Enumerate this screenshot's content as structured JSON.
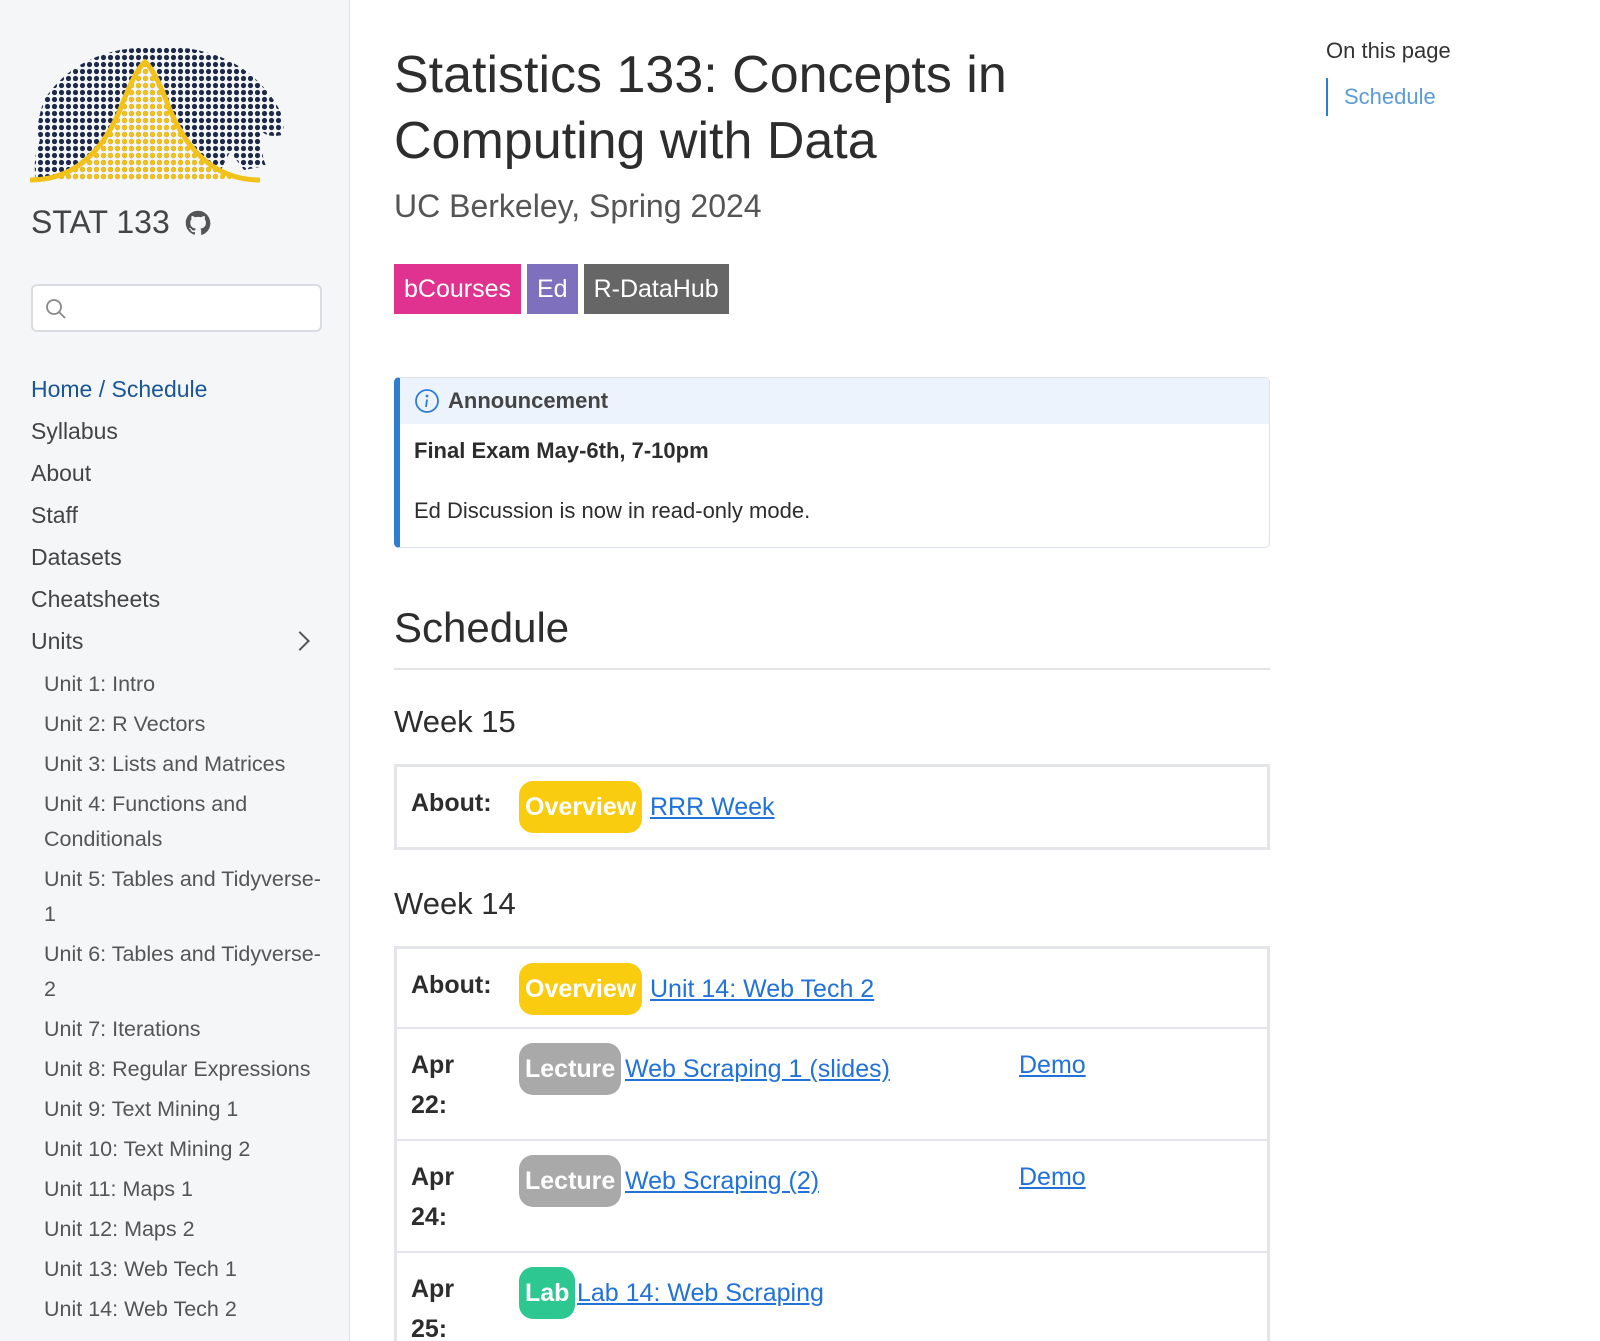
{
  "sidebar": {
    "site_title": "STAT 133",
    "search": {
      "placeholder": "",
      "value": ""
    },
    "nav": [
      {
        "label": "Home / Schedule",
        "active": true
      },
      {
        "label": "Syllabus"
      },
      {
        "label": "About"
      },
      {
        "label": "Staff"
      },
      {
        "label": "Datasets"
      },
      {
        "label": "Cheatsheets"
      }
    ],
    "units_label": "Units",
    "units": [
      "Unit 1: Intro",
      "Unit 2: R Vectors",
      "Unit 3: Lists and Matrices",
      "Unit 4: Functions and Conditionals",
      "Unit 5: Tables and Tidyverse-1",
      "Unit 6: Tables and Tidyverse-2",
      "Unit 7: Iterations",
      "Unit 8: Regular Expressions",
      "Unit 9: Text Mining 1",
      "Unit 10: Text Mining 2",
      "Unit 11: Maps 1",
      "Unit 12: Maps 2",
      "Unit 13: Web Tech 1",
      "Unit 14: Web Tech 2"
    ]
  },
  "main": {
    "title": "Statistics 133: Concepts in Computing with Data",
    "subtitle": "UC Berkeley, Spring 2024",
    "badges": [
      {
        "label": "bCourses",
        "color": "#e0338f"
      },
      {
        "label": "Ed",
        "color": "#7e70bd"
      },
      {
        "label": "R-DataHub",
        "color": "#666666"
      }
    ],
    "announcement": {
      "heading": "Announcement",
      "bold_line": "Final Exam May-6th, 7-10pm",
      "line": "Ed Discussion is now in read-only mode."
    },
    "schedule_heading": "Schedule",
    "weeks": [
      {
        "title": "Week 15",
        "rows": [
          {
            "label": "About:",
            "pill": "Overview",
            "link": "RRR Week"
          }
        ]
      },
      {
        "title": "Week 14",
        "rows": [
          {
            "label": "About:",
            "pill": "Overview",
            "link": "Unit 14: Web Tech 2"
          },
          {
            "label_line1": "Apr",
            "label_line2": "22:",
            "pill": "Lecture",
            "link": "Web Scraping 1 (slides)",
            "extra": "Demo"
          },
          {
            "label_line1": "Apr",
            "label_line2": "24:",
            "pill": "Lecture",
            "link": "Web Scraping (2)",
            "extra": "Demo"
          },
          {
            "label_line1": "Apr",
            "label_line2": "25:",
            "pill": "Lab",
            "link": "Lab 14: Web Scraping"
          }
        ]
      }
    ]
  },
  "toc": {
    "heading": "On this page",
    "items": [
      "Schedule"
    ]
  }
}
